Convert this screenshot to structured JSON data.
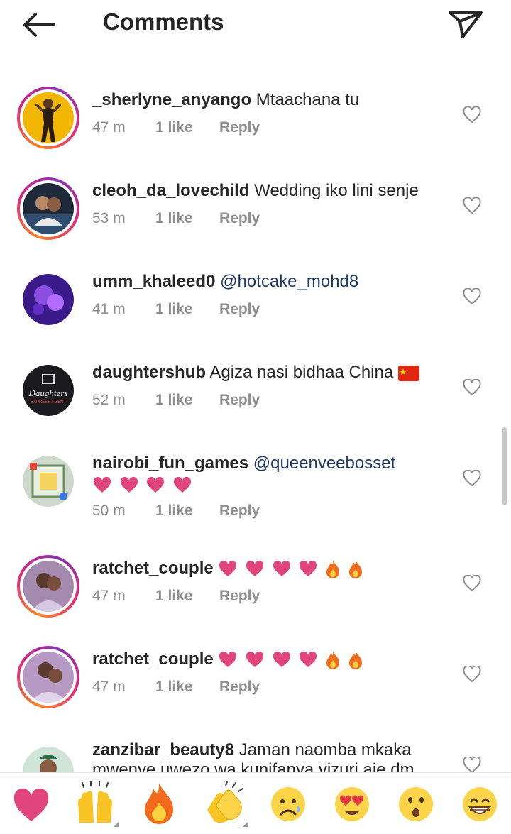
{
  "header": {
    "title": "Comments",
    "back_icon": "arrow-left-icon",
    "share_icon": "paper-plane-icon"
  },
  "comments": [
    {
      "username": "_sherlyne_anyango",
      "text": "Mtaachana tu",
      "time": "47 m",
      "likes": "1 like",
      "reply": "Reply"
    },
    {
      "username": "cleoh_da_lovechild",
      "text": "Wedding iko lini senje",
      "time": "53 m",
      "likes": "1 like",
      "reply": "Reply"
    },
    {
      "username": "umm_khaleed0",
      "mention": "@hotcake_mohd8",
      "time": "41 m",
      "likes": "1 like",
      "reply": "Reply"
    },
    {
      "username": "daughtershub",
      "text": "Agiza nasi bidhaa China",
      "time": "52 m",
      "likes": "1 like",
      "reply": "Reply",
      "avatar_text": "Daughters",
      "avatar_subtext": "EXPRESS AGENT"
    },
    {
      "username": "nairobi_fun_games",
      "mention": "@queenveebosset",
      "time": "50 m",
      "likes": "1 like",
      "reply": "Reply"
    },
    {
      "username": "ratchet_couple",
      "time": "47 m",
      "likes": "1 like",
      "reply": "Reply"
    },
    {
      "username": "ratchet_couple",
      "time": "47 m",
      "likes": "1 like",
      "reply": "Reply"
    },
    {
      "username": "zanzibar_beauty8",
      "text": "Jaman naomba mkaka",
      "text2": "mwenye uwezo wa kunifanya vizuri aje dm"
    }
  ],
  "emoji_bar": [
    "heart",
    "raising-hands",
    "fire",
    "clapping-hands",
    "frowning-face",
    "heart-eyes",
    "hushed-face",
    "grinning-face"
  ],
  "colors": {
    "text": "#262626",
    "meta": "#8e8e8e",
    "mention": "#1e3a64",
    "heart_pink": "#e0457b"
  }
}
